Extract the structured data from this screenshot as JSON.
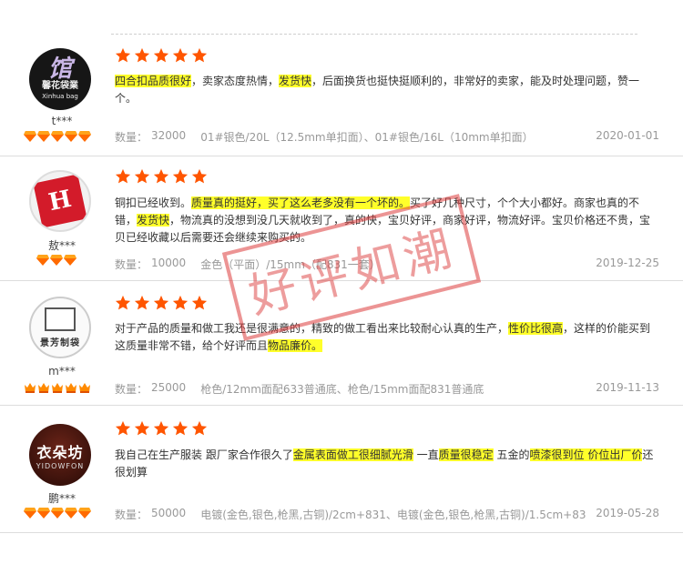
{
  "reviews": [
    {
      "avatar": {
        "icon": "shop-logo-dark",
        "line1": "馆",
        "line2": "馨花袋業",
        "line3": "Xinhua bag"
      },
      "username": "t***",
      "badge_count": 5,
      "badge_icon": "diamond-icon",
      "stars": 5,
      "content_segments": [
        {
          "text": "四合扣品质很好",
          "highlight": true
        },
        {
          "text": "，卖家态度热情，",
          "highlight": false
        },
        {
          "text": "发货快",
          "highlight": true
        },
        {
          "text": "，后面换货也挺快挺顺利的，非常好的卖家，能及时处理问题，赞一个。",
          "highlight": false
        }
      ],
      "qty_label": "数量：",
      "qty": "32000",
      "sku": "01#银色/20L（12.5mm单扣面）、01#银色/16L（10mm单扣面）",
      "date": "2020-01-01"
    },
    {
      "avatar": {
        "icon": "shop-logo-red",
        "line1": "H"
      },
      "username": "敖***",
      "badge_count": 3,
      "badge_icon": "diamond-icon",
      "stars": 5,
      "content_segments": [
        {
          "text": "铜扣已经收到。",
          "highlight": false
        },
        {
          "text": "质量真的挺好，买了这么老多没有一个坏的。",
          "highlight": true
        },
        {
          "text": "买了好几种尺寸，个个大小都好。商家也真的不错，",
          "highlight": false
        },
        {
          "text": "发货快",
          "highlight": true
        },
        {
          "text": "，物流真的没想到没几天就收到了，真的快，宝贝好评，商家好评，物流好评。宝贝价格还不贵，宝贝已经收藏以后需要还会继续来购买的。",
          "highlight": false
        }
      ],
      "qty_label": "数量：",
      "qty": "10000",
      "sku": "金色（平面）/15mm（配831一套）",
      "date": "2019-12-25"
    },
    {
      "avatar": {
        "icon": "shop-logo-box",
        "line1": "景芳制袋"
      },
      "username": "m***",
      "badge_count": 5,
      "badge_icon": "crown-icon",
      "stars": 5,
      "content_segments": [
        {
          "text": "对于产品的质量和做工我还是很满意的，精致的做工看出来比较耐心认真的生产，",
          "highlight": false
        },
        {
          "text": "性价比很高",
          "highlight": true
        },
        {
          "text": "，这样的价能买到这质量非常不错，给个好评而且",
          "highlight": false
        },
        {
          "text": "物品廉价。",
          "highlight": true
        }
      ],
      "qty_label": "数量：",
      "qty": "25000",
      "sku": "枪色/12mm面配633普通底、枪色/15mm面配831普通底",
      "date": "2019-11-13"
    },
    {
      "avatar": {
        "icon": "shop-logo-yidowfon",
        "line1": "衣朵坊",
        "line2": "YIDOWFON"
      },
      "username": "鹏***",
      "badge_count": 5,
      "badge_icon": "diamond-icon",
      "stars": 5,
      "content_segments": [
        {
          "text": "我自己在生产服装 跟厂家合作很久了",
          "highlight": false
        },
        {
          "text": "金属表面做工很细腻光滑",
          "highlight": true
        },
        {
          "text": " 一直",
          "highlight": false
        },
        {
          "text": "质量很稳定",
          "highlight": true
        },
        {
          "text": " 五金的",
          "highlight": false
        },
        {
          "text": "喷漆很到位 价位出厂价",
          "highlight": true
        },
        {
          "text": "还很划算",
          "highlight": false
        }
      ],
      "qty_label": "数量：",
      "qty": "50000",
      "sku": "电镀(金色,银色,枪黑,古铜)/2cm+831、电镀(金色,银色,枪黑,古铜)/1.5cm+831",
      "date": "2019-05-28"
    }
  ],
  "watermark": {
    "text": "好评如潮",
    "color": "#dc3c3c"
  },
  "colors": {
    "star": "#ff5500",
    "highlight": "#ffff2a",
    "diamond": "#ff6a00"
  }
}
